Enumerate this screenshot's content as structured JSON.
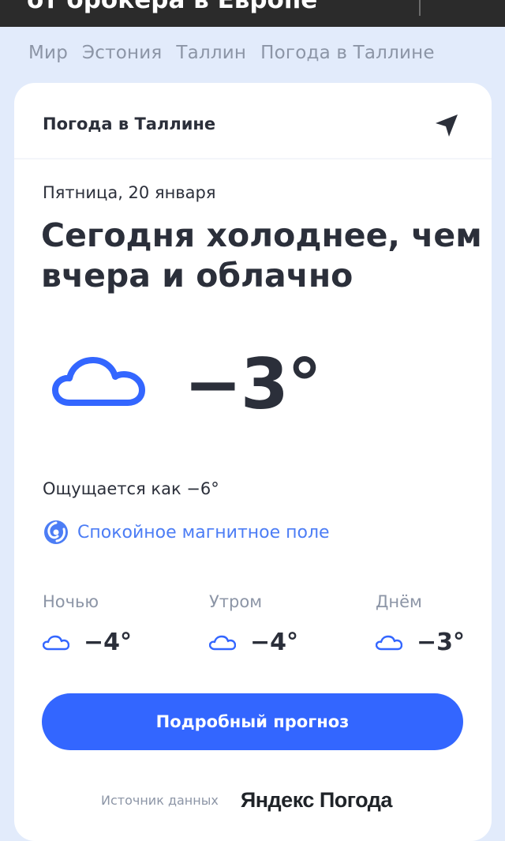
{
  "top_banner": {
    "text": "от брокера в Европе"
  },
  "breadcrumb": [
    "Мир",
    "Эстония",
    "Таллин",
    "Погода в Таллине"
  ],
  "card": {
    "title": "Погода в Таллине",
    "date": "Пятница, 20 января",
    "headline": "Сегодня холоднее, чем вчера и облачно",
    "current_temp": "−3°",
    "current_icon": "cloud-icon",
    "feels_like": "Ощущается как −6°",
    "magnetic": "Спокойное магнитное поле",
    "parts": [
      {
        "label": "Ночью",
        "temp": "−4°"
      },
      {
        "label": "Утром",
        "temp": "−4°"
      },
      {
        "label": "Днём",
        "temp": "−3°"
      }
    ],
    "cta": "Подробный прогноз",
    "source_label": "Источник данных",
    "source_brand": "Яндекс Погода"
  },
  "colors": {
    "background": "#e2ebfb",
    "accent": "#3366ff",
    "cloud": "#3366ff",
    "text": "#2b2f3a",
    "muted": "#8c95a6"
  }
}
